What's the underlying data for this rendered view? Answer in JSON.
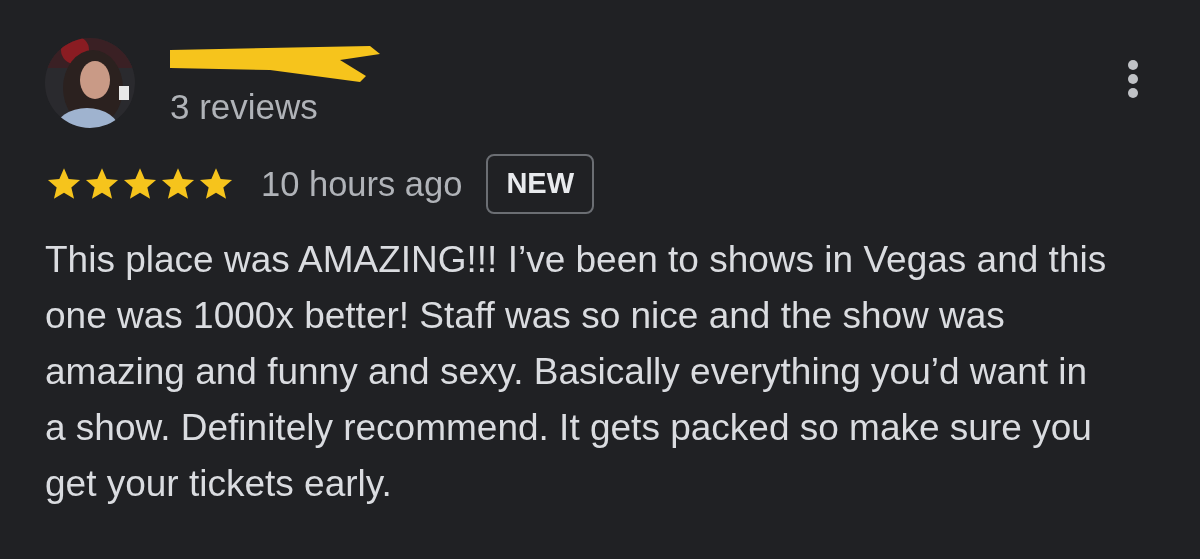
{
  "review": {
    "reviewer_count": "3 reviews",
    "stars": 5,
    "time": "10 hours ago",
    "badge": "NEW",
    "text": "This place was AMAZING!!! I’ve been to shows in Vegas and this one was 1000x better! Staff was so nice and the show was amazing and funny and sexy. Basically everything you’d want in a show. Definitely recommend. It gets packed so make sure you get your tickets early."
  }
}
